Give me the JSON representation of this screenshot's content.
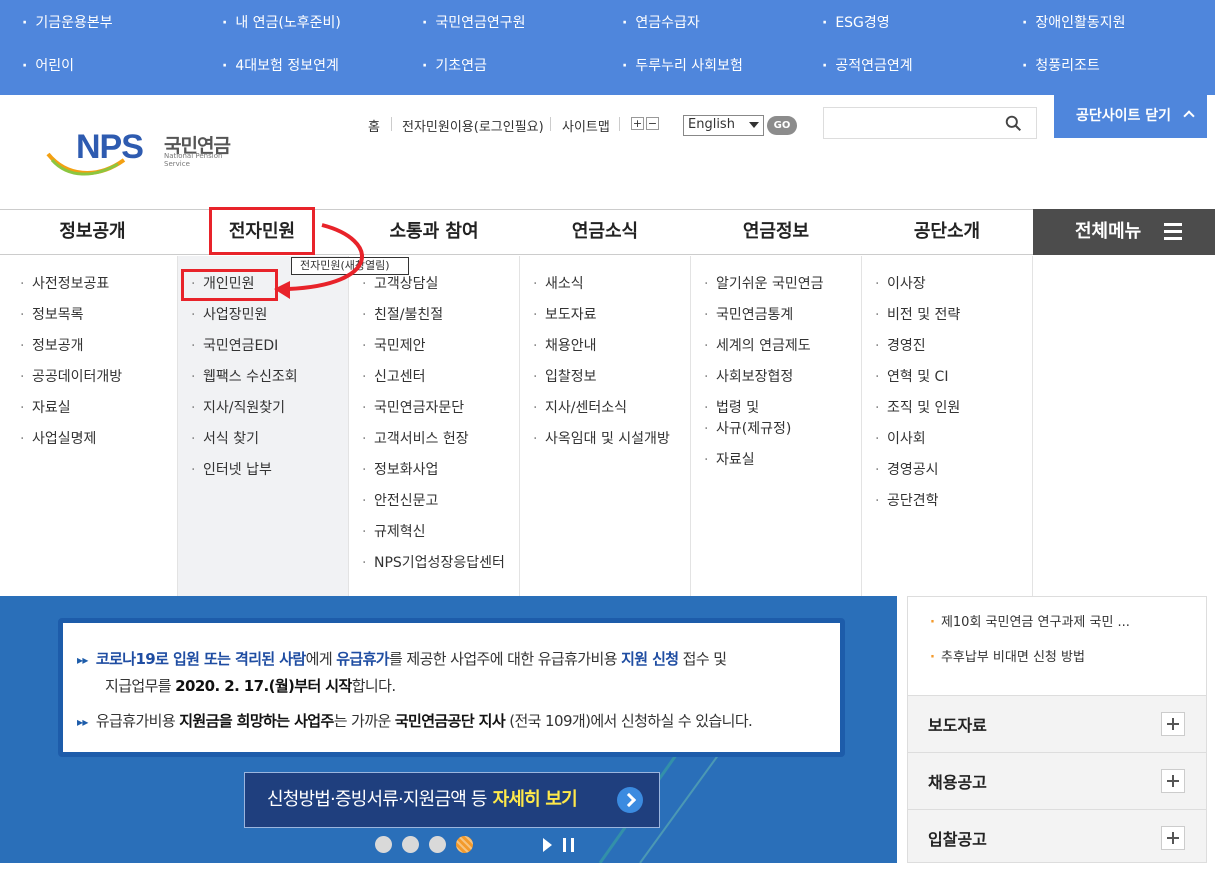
{
  "site_band": {
    "row1": [
      "기금운용본부",
      "내 연금(노후준비)",
      "국민연금연구원",
      "연금수급자",
      "ESG경영",
      "장애인활동지원"
    ],
    "row2": [
      "어린이",
      "4대보험 정보연계",
      "기초연금",
      "두루누리 사회보험",
      "공적연금연계",
      "청풍리조트"
    ]
  },
  "logo": {
    "mark": "NPS",
    "korean": "국민연금",
    "english": "National Pension Service"
  },
  "util": {
    "home": "홈",
    "eservice": "전자민원이용(로그인필요)",
    "sitemap": "사이트맵",
    "zoom_in": "+",
    "zoom_out": "−",
    "language": "English",
    "go": "GO",
    "search_placeholder": "",
    "close_site": "공단사이트 닫기"
  },
  "gnb": {
    "items": [
      "정보공개",
      "전자민원",
      "소통과 참여",
      "연금소식",
      "연금정보",
      "공단소개"
    ],
    "all_menu": "전체메뉴",
    "tooltip": "전자민원(새창열림)"
  },
  "mega": {
    "col1": [
      "사전정보공표",
      "정보목록",
      "정보공개",
      "공공데이터개방",
      "자료실",
      "사업실명제"
    ],
    "col2": [
      "개인민원",
      "사업장민원",
      "국민연금EDI",
      "웹팩스 수신조회",
      "지사/직원찾기",
      "서식 찾기",
      "인터넷 납부"
    ],
    "col3": [
      "고객상담실",
      "친절/불친절",
      "국민제안",
      "신고센터",
      "국민연금자문단",
      "고객서비스 헌장",
      "정보화사업",
      "안전신문고",
      "규제혁신",
      "NPS기업성장응답센터"
    ],
    "col4": [
      "새소식",
      "보도자료",
      "채용안내",
      "입찰정보",
      "지사/센터소식",
      "사옥임대 및 시설개방"
    ],
    "col5": [
      "알기쉬운 국민연금",
      "국민연금통계",
      "세계의 연금제도",
      "사회보장협정",
      "법령 및",
      "사규(제규정)",
      "자료실"
    ],
    "col6": [
      "이사장",
      "비전 및 전략",
      "경영진",
      "연혁 및 CI",
      "조직 및 인원",
      "이사회",
      "경영공시",
      "공단견학"
    ]
  },
  "banner": {
    "l1_a": "코로나19로 입원 또는 격리된 사람",
    "l1_b": "에게 ",
    "l1_c": "유급휴가",
    "l1_d": "를 제공한 사업주에 대한 유급휴가비용 ",
    "l1_e": "지원 신청",
    "l1_f": " 접수 및",
    "l2_a": "지급업무를 ",
    "l2_b": "2020. 2. 17.(월)부터 시작",
    "l2_c": "합니다.",
    "l3_a": "유급휴가비용 ",
    "l3_b": "지원금을 희망하는 사업주",
    "l3_c": "는 가까운 ",
    "l3_d": "국민연금공단 지사",
    "l3_e": " (전국 109개)에서 신청하실 수 있습니다.",
    "detail_a": "신청방법·증빙서류·지원금액 등",
    "detail_b": "자세히 보기"
  },
  "board": {
    "recent": [
      "제10회 국민연금 연구과제 국민 ...",
      "추후납부 비대면 신청 방법"
    ],
    "sections": [
      "보도자료",
      "채용공고",
      "입찰공고"
    ]
  },
  "colors": {
    "band": "#4f86dc",
    "highlight": "#e8232a",
    "banner": "#2a6fb9"
  }
}
